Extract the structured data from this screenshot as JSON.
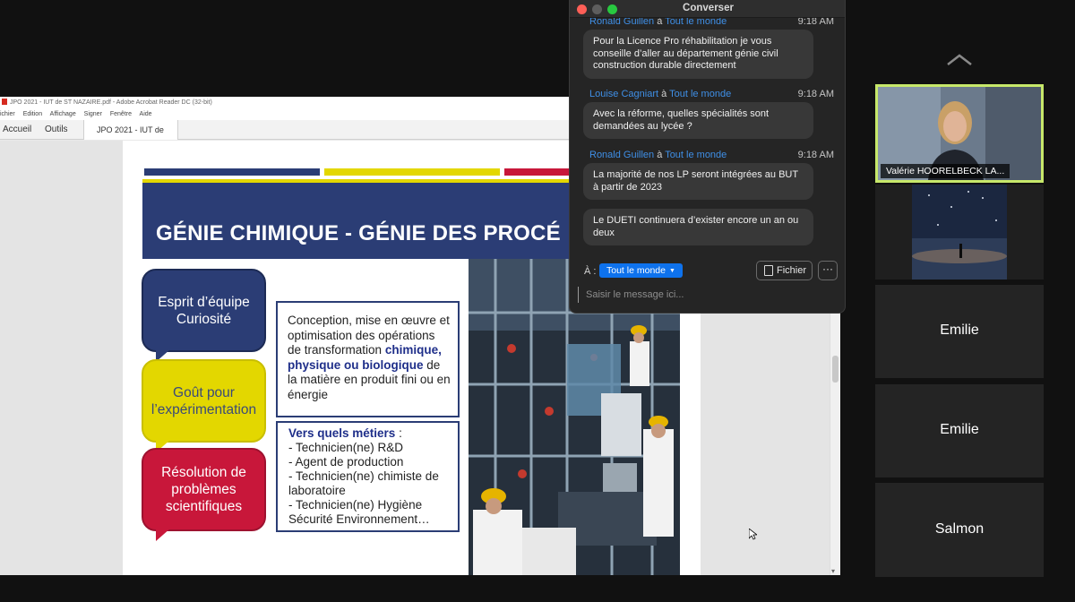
{
  "acrobat": {
    "window_title": "JPO 2021 - IUT de ST NAZAIRE.pdf - Adobe Acrobat Reader DC (32-bit)",
    "menu": [
      "ichier",
      "Edition",
      "Affichage",
      "Signer",
      "Fenêtre",
      "Aide"
    ],
    "tabs": {
      "home": "Accueil",
      "tools": "Outils",
      "doc": "JPO 2021 - IUT de ..."
    }
  },
  "slide": {
    "title": "GÉNIE CHIMIQUE - GÉNIE DES PROCÉ",
    "bubbles": [
      {
        "line1": "Esprit d’équipe",
        "line2": "Curiosité"
      },
      {
        "line1": "Goût pour",
        "line2": "l’expérimentation"
      },
      {
        "line1": "Résolution de",
        "line2": "problèmes",
        "line3": "scientifiques"
      }
    ],
    "box1": {
      "text_a": "Conception, mise en œuvre et optimisation des opérations de transformation ",
      "highlight": "chimique, physique ou biologique",
      "text_b": " de la matière en produit fini ou en énergie"
    },
    "box2": {
      "heading": "Vers quels métiers",
      "colon": " :",
      "items": [
        "- Technicien(ne) R&D",
        "- Agent de production",
        "- Technicien(ne) chimiste de laboratoire",
        "- Technicien(ne) Hygiène Sécurité Environnement…"
      ]
    },
    "colors": {
      "navy": "#2b3d75",
      "yellow": "#e3d700",
      "red": "#c8173a"
    }
  },
  "chat": {
    "title": "Converser",
    "messages": [
      {
        "sender": "Ronald Guillen",
        "prep": " à ",
        "to": "Tout le monde",
        "time": "9:18 AM",
        "text": "Pour la Licence Pro réhabilitation je vous conseille d’aller au département génie civil construction durable directement"
      },
      {
        "sender": "Louise Cagniart",
        "prep": " à ",
        "to": "Tout le monde",
        "time": "9:18 AM",
        "text": "Avec la réforme, quelles spécialités sont demandées au lycée ?"
      },
      {
        "sender": "Ronald Guillen",
        "prep": " à ",
        "to": "Tout le monde",
        "time": "9:18 AM",
        "text": "La majorité de nos LP seront intégrées au BUT à partir de 2023"
      },
      {
        "text": "Le DUETI continuera d’exister encore un an ou deux"
      }
    ],
    "to_label": "À :",
    "recipient": "Tout le monde",
    "file_button": "Fichier",
    "more_button": "···",
    "input_placeholder": "Saisir le message ici..."
  },
  "participants": [
    {
      "name": "Valérie HOORELBECK LA..."
    },
    {
      "name": ""
    },
    {
      "name": "Emilie"
    },
    {
      "name": "Emilie"
    },
    {
      "name": "Salmon"
    }
  ]
}
